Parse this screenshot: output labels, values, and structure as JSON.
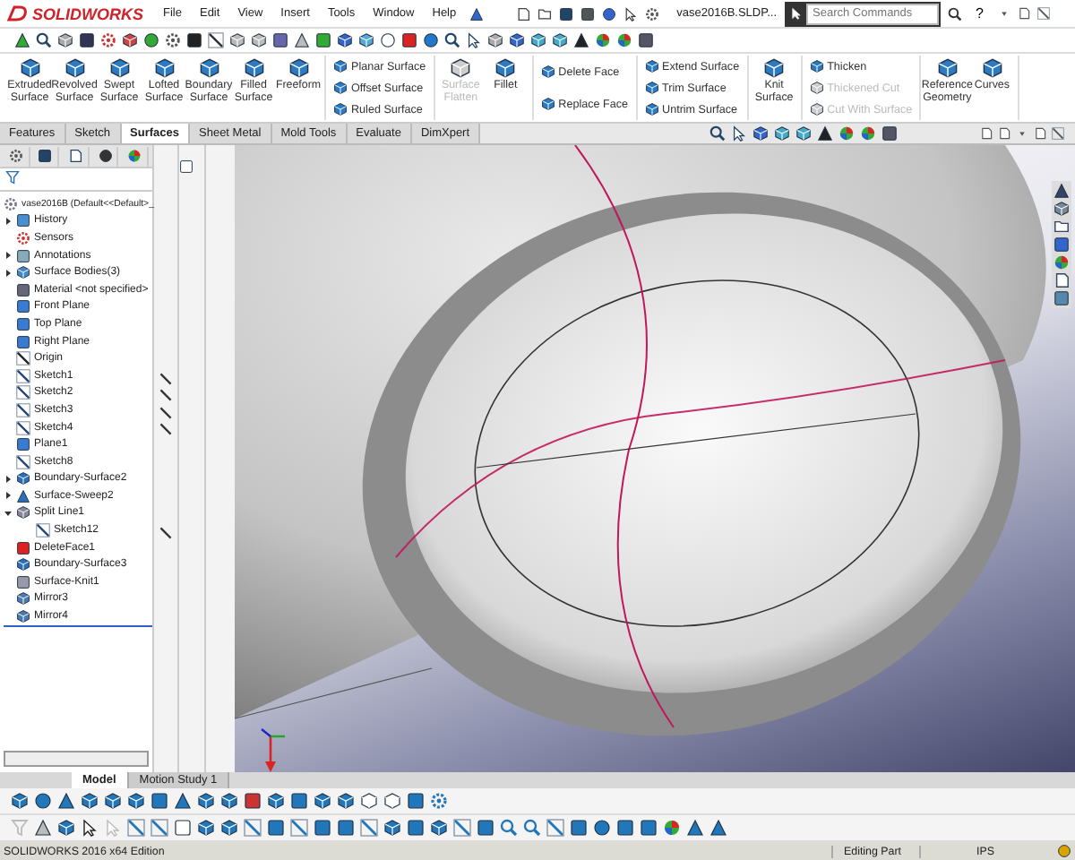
{
  "window": {
    "logo": "SOLIDWORKS",
    "title": "vase2016B.SLDP...",
    "search": {
      "placeholder": "Search Commands"
    },
    "help": "?"
  },
  "menu": [
    "File",
    "Edit",
    "View",
    "Insert",
    "Tools",
    "Window",
    "Help"
  ],
  "ribbon": [
    {
      "kind": "large",
      "items": [
        {
          "label": "Extruded Surface",
          "disabled": false
        },
        {
          "label": "Revolved Surface",
          "disabled": false
        },
        {
          "label": "Swept Surface",
          "disabled": false
        },
        {
          "label": "Lofted Surface",
          "disabled": false
        },
        {
          "label": "Boundary Surface",
          "disabled": false
        },
        {
          "label": "Filled Surface",
          "disabled": false
        },
        {
          "label": "Freeform",
          "disabled": false
        }
      ]
    },
    {
      "kind": "small",
      "items": [
        {
          "label": "Planar Surface",
          "disabled": false
        },
        {
          "label": "Offset Surface",
          "disabled": false
        },
        {
          "label": "Ruled Surface",
          "disabled": false
        }
      ]
    },
    {
      "kind": "large",
      "items": [
        {
          "label": "Surface Flatten",
          "disabled": true
        },
        {
          "label": "Fillet",
          "disabled": false
        }
      ]
    },
    {
      "kind": "small",
      "items": [
        {
          "label": "Delete Face",
          "disabled": false
        },
        {
          "label": "Replace Face",
          "disabled": false
        }
      ]
    },
    {
      "kind": "small",
      "items": [
        {
          "label": "Extend Surface",
          "disabled": false
        },
        {
          "label": "Trim Surface",
          "disabled": false
        },
        {
          "label": "Untrim Surface",
          "disabled": false
        }
      ]
    },
    {
      "kind": "large",
      "items": [
        {
          "label": "Knit Surface",
          "disabled": false
        }
      ]
    },
    {
      "kind": "small",
      "items": [
        {
          "label": "Thicken",
          "disabled": false
        },
        {
          "label": "Thickened Cut",
          "disabled": true
        },
        {
          "label": "Cut With Surface",
          "disabled": true
        }
      ]
    },
    {
      "kind": "large",
      "items": [
        {
          "label": "Reference Geometry",
          "disabled": false
        },
        {
          "label": "Curves",
          "disabled": false
        }
      ]
    }
  ],
  "tabs": [
    {
      "label": "Features",
      "selected": false
    },
    {
      "label": "Sketch",
      "selected": false
    },
    {
      "label": "Surfaces",
      "selected": true
    },
    {
      "label": "Sheet Metal",
      "selected": false
    },
    {
      "label": "Mold Tools",
      "selected": false
    },
    {
      "label": "Evaluate",
      "selected": false
    },
    {
      "label": "DimXpert",
      "selected": false
    }
  ],
  "feature_tree": {
    "root": "vase2016B  (Default<<Default>_",
    "items": [
      {
        "label": "History",
        "kind": "history",
        "expanded": false,
        "marked": false
      },
      {
        "label": "Sensors",
        "kind": "sensors",
        "marked": false
      },
      {
        "label": "Annotations",
        "kind": "annotations",
        "expanded": false,
        "marked": false
      },
      {
        "label": "Surface Bodies(3)",
        "kind": "bodies",
        "expanded": false,
        "marked": false
      },
      {
        "label": "Material <not specified>",
        "kind": "material",
        "marked": false
      },
      {
        "label": "Front Plane",
        "kind": "plane",
        "marked": false
      },
      {
        "label": "Top Plane",
        "kind": "plane",
        "marked": false
      },
      {
        "label": "Right Plane",
        "kind": "plane",
        "marked": false
      },
      {
        "label": "Origin",
        "kind": "origin",
        "marked": false
      },
      {
        "label": "Sketch1",
        "kind": "sketch",
        "marked": true
      },
      {
        "label": "Sketch2",
        "kind": "sketch",
        "marked": true
      },
      {
        "label": "Sketch3",
        "kind": "sketch",
        "marked": true
      },
      {
        "label": "Sketch4",
        "kind": "sketch",
        "marked": true
      },
      {
        "label": "Plane1",
        "kind": "plane",
        "marked": false
      },
      {
        "label": "Sketch8",
        "kind": "sketch",
        "marked": false
      },
      {
        "label": "Boundary-Surface2",
        "kind": "surface",
        "expanded": false,
        "marked": false
      },
      {
        "label": "Surface-Sweep2",
        "kind": "sweep",
        "expanded": false,
        "marked": false
      },
      {
        "label": "Split Line1",
        "kind": "split",
        "expanded": true,
        "marked": false,
        "children": [
          {
            "label": "Sketch12",
            "kind": "sketch",
            "marked": true
          }
        ]
      },
      {
        "label": "DeleteFace1",
        "kind": "delete",
        "marked": false
      },
      {
        "label": "Boundary-Surface3",
        "kind": "surface",
        "marked": false
      },
      {
        "label": "Surface-Knit1",
        "kind": "knit",
        "marked": false
      },
      {
        "label": "Mirror3",
        "kind": "mirror",
        "marked": false
      },
      {
        "label": "Mirror4",
        "kind": "mirror",
        "marked": false
      }
    ]
  },
  "bottom_tabs": [
    {
      "label": "Model",
      "selected": true
    },
    {
      "label": "Motion Study 1",
      "selected": false
    }
  ],
  "status_bar": {
    "edition": "SOLIDWORKS 2016 x64 Edition",
    "mode": "Editing Part",
    "units": "IPS"
  }
}
